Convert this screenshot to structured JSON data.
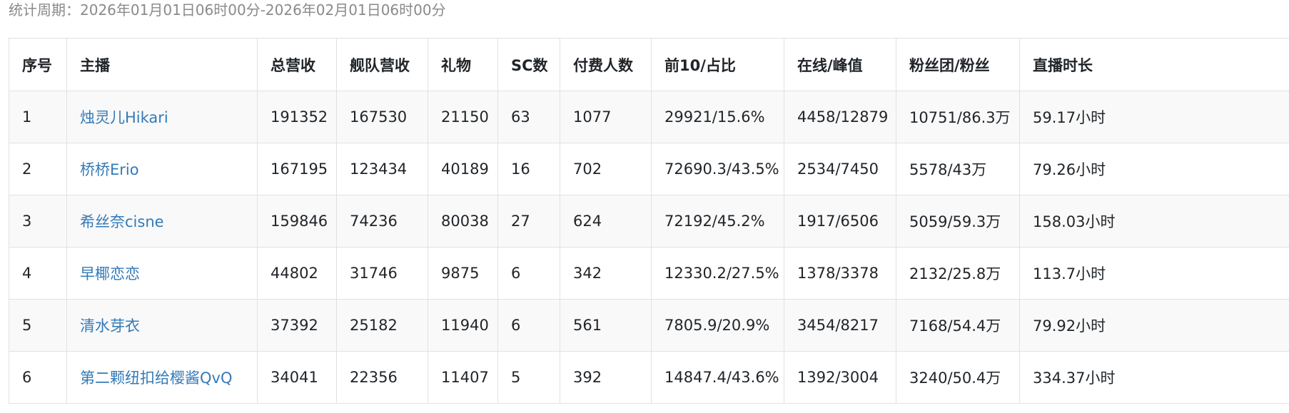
{
  "period_text": "统计周期：2026年01月01日06时00分-2026年02月01日06时00分",
  "table": {
    "headers": [
      "序号",
      "主播",
      "总营收",
      "舰队营收",
      "礼物",
      "SC数",
      "付费人数",
      "前10/占比",
      "在线/峰值",
      "粉丝团/粉丝",
      "直播时长"
    ],
    "rows": [
      [
        "1",
        "烛灵儿Hikari",
        "191352",
        "167530",
        "21150",
        "63",
        "1077",
        "29921/15.6%",
        "4458/12879",
        "10751/86.3万",
        "59.17小时"
      ],
      [
        "2",
        "桥桥Erio",
        "167195",
        "123434",
        "40189",
        "16",
        "702",
        "72690.3/43.5%",
        "2534/7450",
        "5578/43万",
        "79.26小时"
      ],
      [
        "3",
        "希丝奈cisne",
        "159846",
        "74236",
        "80038",
        "27",
        "624",
        "72192/45.2%",
        "1917/6506",
        "5059/59.3万",
        "158.03小时"
      ],
      [
        "4",
        "早椰恋恋",
        "44802",
        "31746",
        "9875",
        "6",
        "342",
        "12330.2/27.5%",
        "1378/3378",
        "2132/25.8万",
        "113.7小时"
      ],
      [
        "5",
        "清水芽衣",
        "37392",
        "25182",
        "11940",
        "6",
        "561",
        "7805.9/20.9%",
        "3454/8217",
        "7168/54.4万",
        "79.92小时"
      ],
      [
        "6",
        "第二颗纽扣给樱酱QvQ",
        "34041",
        "22356",
        "11407",
        "5",
        "392",
        "14847.4/43.6%",
        "1392/3004",
        "3240/50.4万",
        "334.37小时"
      ]
    ]
  },
  "colors": {
    "link": "#337ab7",
    "muted_text": "#8a8a8a",
    "border": "#dee2e6",
    "stripe": "#f9f9f9"
  }
}
